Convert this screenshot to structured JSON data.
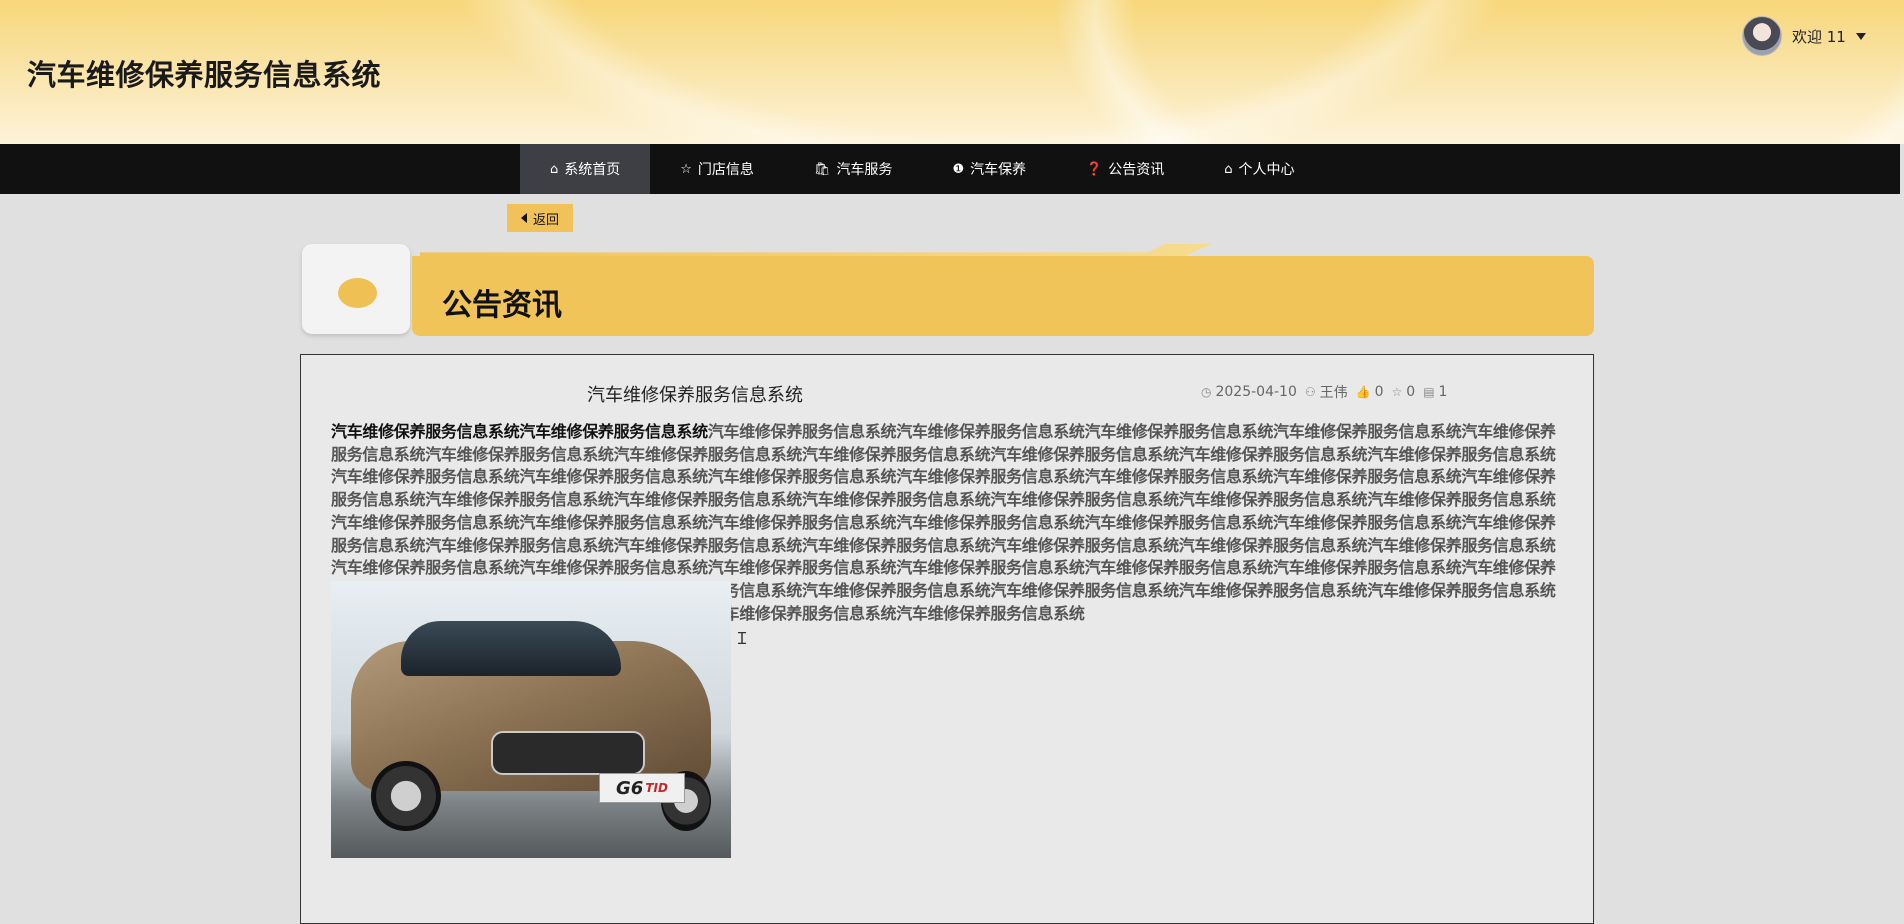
{
  "header": {
    "site_title": "汽车维修保养服务信息系统",
    "welcome": "欢迎 11"
  },
  "nav": {
    "items": [
      {
        "label": "系统首页",
        "icon": "home-icon",
        "active": true
      },
      {
        "label": "门店信息",
        "icon": "star-icon",
        "active": false
      },
      {
        "label": "汽车服务",
        "icon": "bag-icon",
        "active": false
      },
      {
        "label": "汽车保养",
        "icon": "info-icon",
        "active": false
      },
      {
        "label": "公告资讯",
        "icon": "question-icon",
        "active": false
      },
      {
        "label": "个人中心",
        "icon": "home-icon",
        "active": false
      }
    ]
  },
  "back_button": {
    "label": "返回"
  },
  "section": {
    "title": "公告资讯"
  },
  "article": {
    "title": "汽车维修保养服务信息系统",
    "date": "2025-04-10",
    "author": "王伟",
    "likes": "0",
    "favorites": "0",
    "comments": "1",
    "lead": "汽车维修保养服务信息系统汽车维修保养服务信息系统",
    "body": "汽车维修保养服务信息系统汽车维修保养服务信息系统汽车维修保养服务信息系统汽车维修保养服务信息系统汽车维修保养服务信息系统汽车维修保养服务信息系统汽车维修保养服务信息系统汽车维修保养服务信息系统汽车维修保养服务信息系统汽车维修保养服务信息系统汽车维修保养服务信息系统汽车维修保养服务信息系统汽车维修保养服务信息系统汽车维修保养服务信息系统汽车维修保养服务信息系统汽车维修保养服务信息系统汽车维修保养服务信息系统汽车维修保养服务信息系统汽车维修保养服务信息系统汽车维修保养服务信息系统汽车维修保养服务信息系统汽车维修保养服务信息系统汽车维修保养服务信息系统汽车维修保养服务信息系统汽车维修保养服务信息系统汽车维修保养服务信息系统汽车维修保养服务信息系统汽车维修保养服务信息系统汽车维修保养服务信息系统汽车维修保养服务信息系统汽车维修保养服务信息系统汽车维修保养服务信息系统汽车维修保养服务信息系统汽车维修保养服务信息系统汽车维修保养服务信息系统汽车维修保养服务信息系统汽车维修保养服务信息系统汽车维修保养服务信息系统汽车维修保养服务信息系统汽车维修保养服务信息系统汽车维修保养服务信息系统汽车维修保养服务信息系统汽车维修保养服务信息系统汽车维修保养服务信息系统汽车维修保养服务信息系统汽车维修保养服务信息系统汽车维修保养服务信息系统汽车维修保养服务信息系统汽车维修保养服务信息系统汽车维修保养服务信息系统汽车维修保养服务信息系统汽车维修保养服务信息系统汽车维修保养服务信息系统汽车维修保养服务信息系统",
    "image_plate_text": "G6",
    "image_plate_suffix": "TID"
  }
}
